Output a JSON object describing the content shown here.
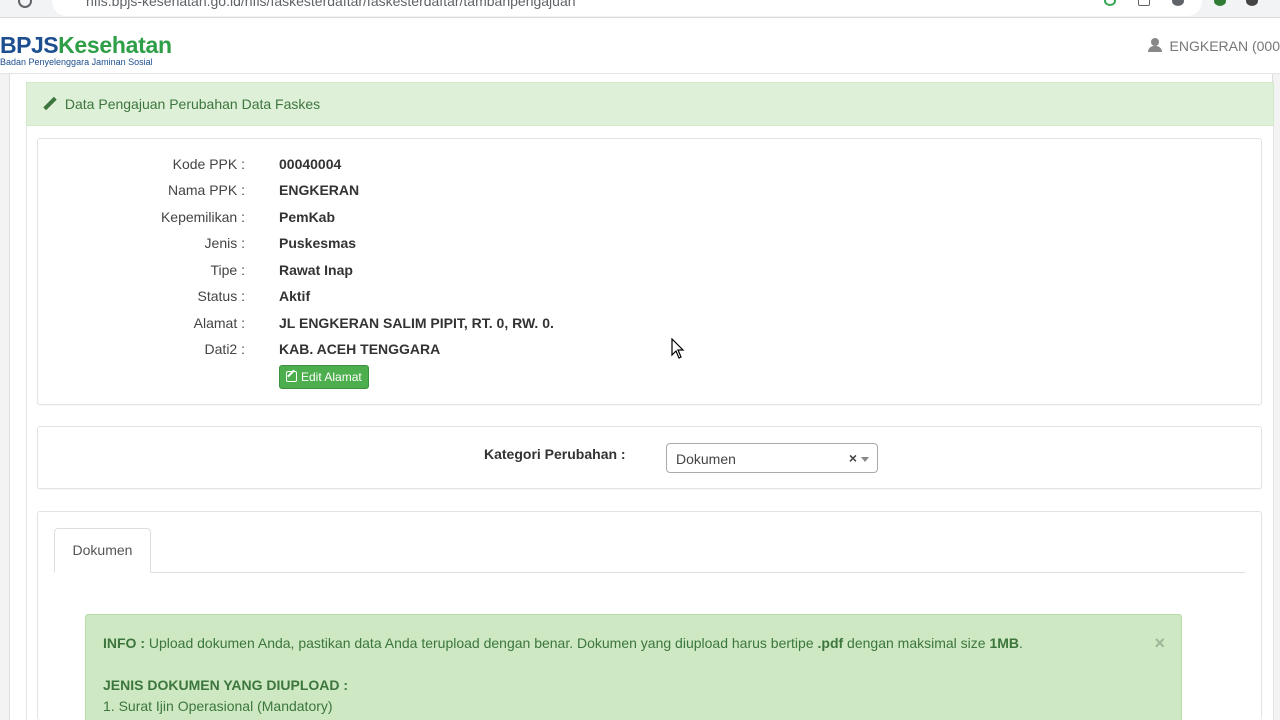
{
  "browser": {
    "url": "hfis.bpjs-kesehatan.go.id/hfis/faskesterdaftar/faskesterdaftar/tambahpengajuan"
  },
  "header": {
    "logo_primary": "BPJS",
    "logo_secondary": "Kesehatan",
    "logo_subtitle": "Badan Penyelenggara Jaminan Sosial",
    "user_label": "ENGKERAN (000"
  },
  "panel": {
    "title": "Data Pengajuan Perubahan Data Faskes"
  },
  "faskes": {
    "rows": [
      {
        "label": "Kode PPK :",
        "value": "00040004"
      },
      {
        "label": "Nama PPK :",
        "value": "ENGKERAN"
      },
      {
        "label": "Kepemilikan :",
        "value": "PemKab"
      },
      {
        "label": "Jenis :",
        "value": "Puskesmas"
      },
      {
        "label": "Tipe :",
        "value": "Rawat Inap"
      },
      {
        "label": "Status :",
        "value": "Aktif"
      },
      {
        "label": "Alamat :",
        "value": "JL ENGKERAN SALIM PIPIT, RT. 0, RW. 0."
      },
      {
        "label": "Dati2 :",
        "value": "KAB. ACEH TENGGARA"
      }
    ],
    "edit_button": "Edit Alamat"
  },
  "kategori": {
    "label": "Kategori Perubahan :",
    "selected": "Dokumen",
    "clear": "×"
  },
  "tabs": [
    {
      "label": "Dokumen",
      "active": true
    }
  ],
  "alert": {
    "prefix": "INFO :",
    "text_a": " Upload dokumen Anda, pastikan data Anda terupload dengan benar. Dokumen yang diupload harus bertipe ",
    "ext": ".pdf",
    "text_b": " dengan maksimal size ",
    "size": "1MB",
    "text_c": ".",
    "close": "×",
    "heading": "JENIS DOKUMEN YANG DIUPLOAD :",
    "items": [
      "1. Surat Ijin Operasional (Mandatory)"
    ]
  },
  "colors": {
    "brand_blue": "#1d4e8f",
    "brand_green": "#2e9f47",
    "success_bg": "#dff0d8",
    "success_text": "#3c763d",
    "button_green": "#4cae4c"
  }
}
